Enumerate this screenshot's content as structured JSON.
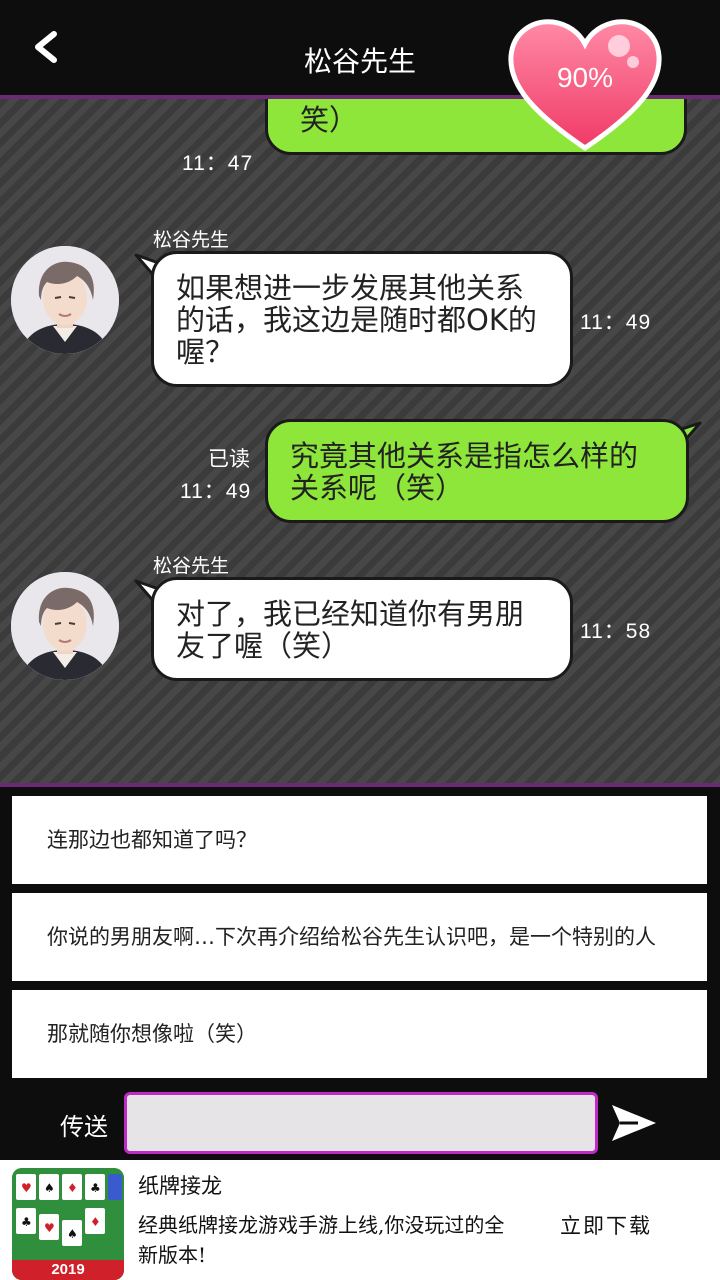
{
  "header": {
    "title": "松谷先生",
    "affection": "90%"
  },
  "chat": {
    "partial_time": "11：47",
    "partial_text": "笑）",
    "messages": [
      {
        "sender": "松谷先生",
        "text": "如果想进一步发展其他关系的话，我这边是随时都OK的喔？",
        "time": "11：49"
      },
      {
        "read": "已读",
        "time": "11：49",
        "text": "究竟其他关系是指怎么样的关系呢（笑）"
      },
      {
        "sender": "松谷先生",
        "text": "对了，我已经知道你有男朋友了喔（笑）",
        "time": "11：58"
      }
    ]
  },
  "choices": [
    "连那边也都知道了吗？",
    "你说的男朋友啊…下次再介绍给松谷先生认识吧，是一个特别的人",
    "那就随你想像啦（笑）"
  ],
  "input": {
    "send_label": "传送",
    "value": ""
  },
  "ad": {
    "title": "纸牌接龙",
    "description": "经典纸牌接龙游戏手游上线,你没玩过的全新版本!",
    "cta": "立即下载",
    "icon_year": "2019"
  },
  "colors": {
    "accent_purple": "#6b2a74",
    "input_border": "#c02bc8",
    "green_bubble": "#8ee63a",
    "heart_pink": "#ff5a80"
  }
}
